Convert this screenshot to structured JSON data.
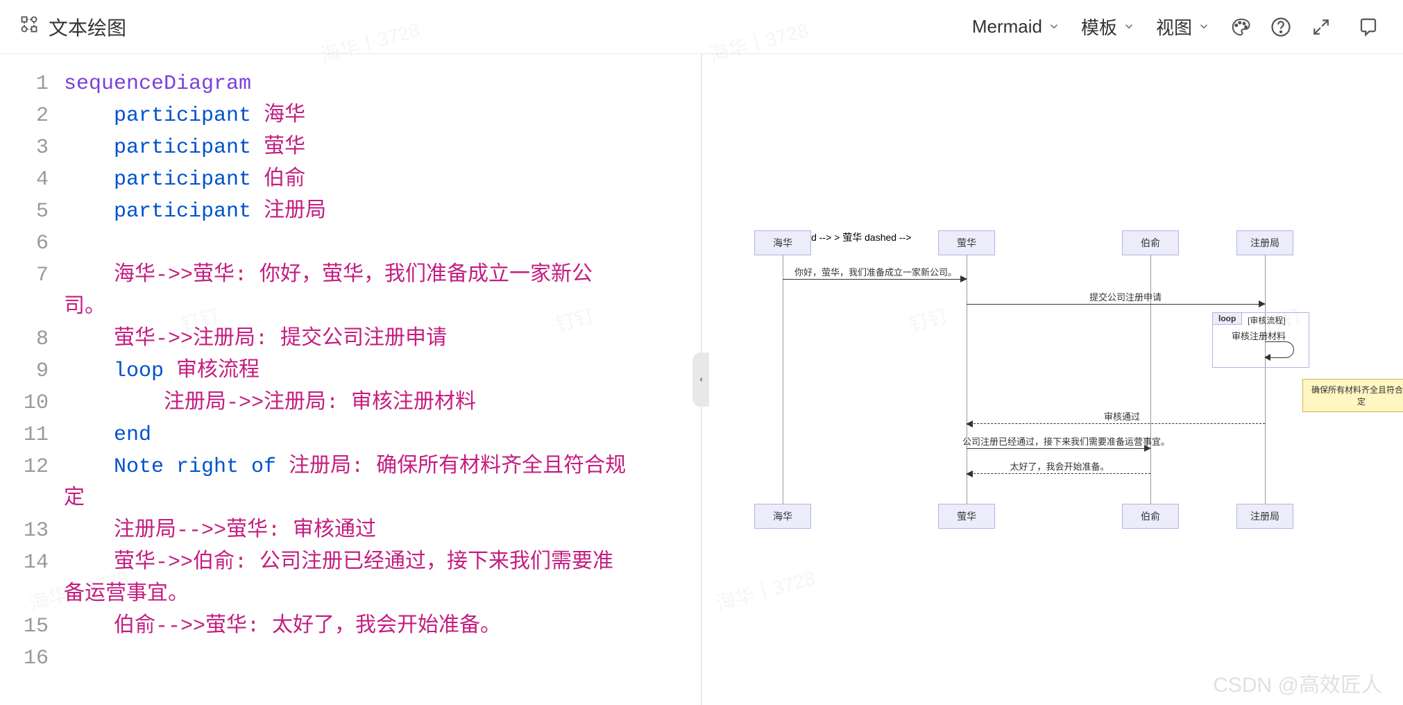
{
  "toolbar": {
    "title": "文本绘图",
    "renderer": "Mermaid",
    "template": "模板",
    "view": "视图"
  },
  "code": {
    "lines": [
      {
        "n": 1,
        "segs": [
          {
            "t": "sequenceDiagram",
            "c": "tok-type"
          }
        ]
      },
      {
        "n": 2,
        "segs": [
          {
            "t": "    ",
            "c": ""
          },
          {
            "t": "participant",
            "c": "tok-kw"
          },
          {
            "t": " ",
            "c": ""
          },
          {
            "t": "海华",
            "c": "tok-name"
          }
        ]
      },
      {
        "n": 3,
        "segs": [
          {
            "t": "    ",
            "c": ""
          },
          {
            "t": "participant",
            "c": "tok-kw"
          },
          {
            "t": " ",
            "c": ""
          },
          {
            "t": "萤华",
            "c": "tok-name"
          }
        ]
      },
      {
        "n": 4,
        "segs": [
          {
            "t": "    ",
            "c": ""
          },
          {
            "t": "participant",
            "c": "tok-kw"
          },
          {
            "t": " ",
            "c": ""
          },
          {
            "t": "伯俞",
            "c": "tok-name"
          }
        ]
      },
      {
        "n": 5,
        "segs": [
          {
            "t": "    ",
            "c": ""
          },
          {
            "t": "participant",
            "c": "tok-kw"
          },
          {
            "t": " ",
            "c": ""
          },
          {
            "t": "注册局",
            "c": "tok-name"
          }
        ]
      },
      {
        "n": 6,
        "segs": []
      },
      {
        "n": 7,
        "segs": [
          {
            "t": "    ",
            "c": ""
          },
          {
            "t": "海华->>萤华: 你好，萤华，我们准备成立一家新公",
            "c": "tok-name"
          }
        ],
        "wrap": [
          {
            "t": "司。",
            "c": "tok-name"
          }
        ]
      },
      {
        "n": 8,
        "segs": [
          {
            "t": "    ",
            "c": ""
          },
          {
            "t": "萤华->>注册局: 提交公司注册申请",
            "c": "tok-name"
          }
        ]
      },
      {
        "n": 9,
        "segs": [
          {
            "t": "    ",
            "c": ""
          },
          {
            "t": "loop",
            "c": "tok-kw"
          },
          {
            "t": " ",
            "c": ""
          },
          {
            "t": "审核流程",
            "c": "tok-name"
          }
        ]
      },
      {
        "n": 10,
        "segs": [
          {
            "t": "        ",
            "c": ""
          },
          {
            "t": "注册局->>注册局: 审核注册材料",
            "c": "tok-name"
          }
        ]
      },
      {
        "n": 11,
        "segs": [
          {
            "t": "    ",
            "c": ""
          },
          {
            "t": "end",
            "c": "tok-kw"
          }
        ]
      },
      {
        "n": 12,
        "segs": [
          {
            "t": "    ",
            "c": ""
          },
          {
            "t": "Note right of",
            "c": "tok-kw"
          },
          {
            "t": " ",
            "c": ""
          },
          {
            "t": "注册局: 确保所有材料齐全且符合规",
            "c": "tok-name"
          }
        ],
        "wrap": [
          {
            "t": "定",
            "c": "tok-name"
          }
        ]
      },
      {
        "n": 13,
        "segs": [
          {
            "t": "    ",
            "c": ""
          },
          {
            "t": "注册局-->>萤华: 审核通过",
            "c": "tok-name"
          }
        ]
      },
      {
        "n": 14,
        "segs": [
          {
            "t": "    ",
            "c": ""
          },
          {
            "t": "萤华->>伯俞: 公司注册已经通过，接下来我们需要准",
            "c": "tok-name"
          }
        ],
        "wrap": [
          {
            "t": "备运营事宜。",
            "c": "tok-name"
          }
        ]
      },
      {
        "n": 15,
        "segs": [
          {
            "t": "    ",
            "c": ""
          },
          {
            "t": "伯俞-->>萤华: 太好了，我会开始准备。",
            "c": "tok-name"
          }
        ]
      },
      {
        "n": 16,
        "segs": []
      }
    ]
  },
  "diagram": {
    "actors": [
      "海华",
      "萤华",
      "伯俞",
      "注册局"
    ],
    "msg1": "你好，萤华，我们准备成立一家新公司。",
    "msg2": "提交公司注册申请",
    "loop_label": "loop",
    "loop_name": "[审核流程]",
    "msg3": "审核注册材料",
    "note": "确保所有材料齐全且符合规定",
    "msg4": "审核通过",
    "msg5": "公司注册已经通过，接下来我们需要准备运营事宜。",
    "msg6": "太好了，我会开始准备。"
  },
  "footer_watermark": "CSDN @高效匠人",
  "bg_watermark": "海华丨3728"
}
